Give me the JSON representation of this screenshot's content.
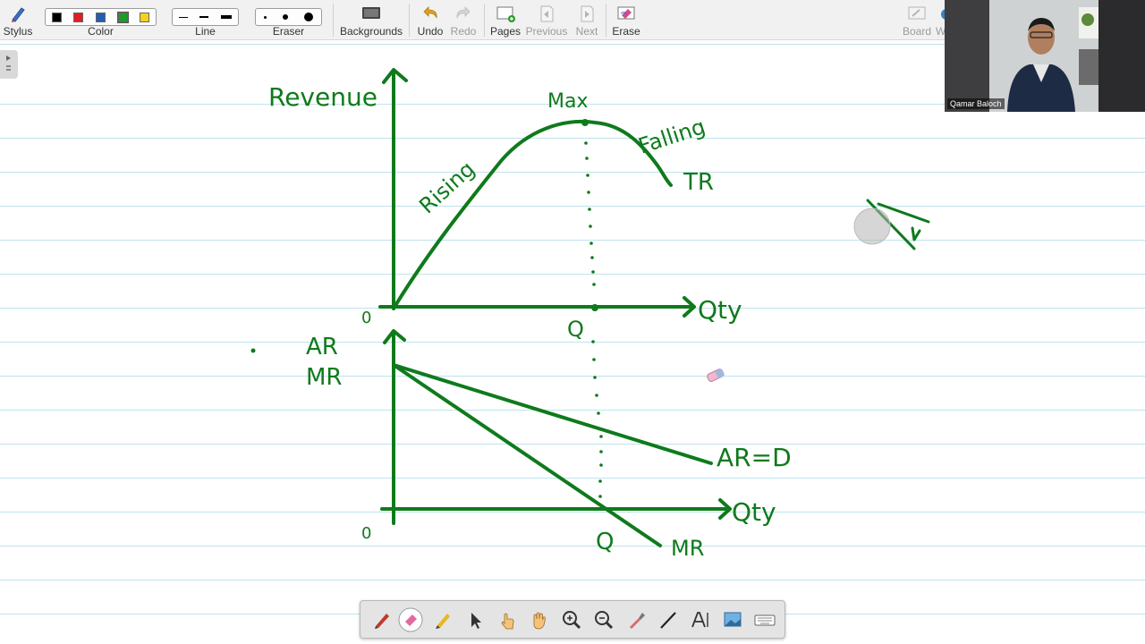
{
  "toolbar": {
    "stylus": "Stylus",
    "color": "Color",
    "line": "Line",
    "eraser": "Eraser",
    "backgrounds": "Backgrounds",
    "undo": "Undo",
    "redo": "Redo",
    "pages": "Pages",
    "previous": "Previous",
    "next": "Next",
    "erase": "Erase",
    "board": "Board",
    "cut_label": "W",
    "color_swatches": [
      "#000000",
      "#e0201f",
      "#1f5fb4",
      "#1d9a2a",
      "#f2d31a"
    ]
  },
  "webcam": {
    "name": "Qamar Baloch"
  },
  "whiteboard": {
    "ink_color": "#0f7a1c",
    "top_graph": {
      "y_label": "Revenue",
      "x_label": "Qty",
      "origin": "0",
      "curve_label": "TR",
      "rising_label": "Rising",
      "falling_label": "Falling",
      "max_label": "Max",
      "q_label": "Q"
    },
    "bottom_graph": {
      "y_label_1": "AR",
      "y_label_2": "MR",
      "x_label": "Qty",
      "origin": "0",
      "ar_label": "AR=D",
      "mr_label": "MR",
      "q_label": "Q"
    }
  },
  "bottom_tools": [
    "pen-tool",
    "eraser-tool",
    "highlighter-tool",
    "select-tool",
    "touch-tool",
    "hand-tool",
    "zoom-in-tool",
    "zoom-out-tool",
    "pipette-tool",
    "line-tool",
    "text-tool",
    "image-tool",
    "keyboard-tool"
  ]
}
